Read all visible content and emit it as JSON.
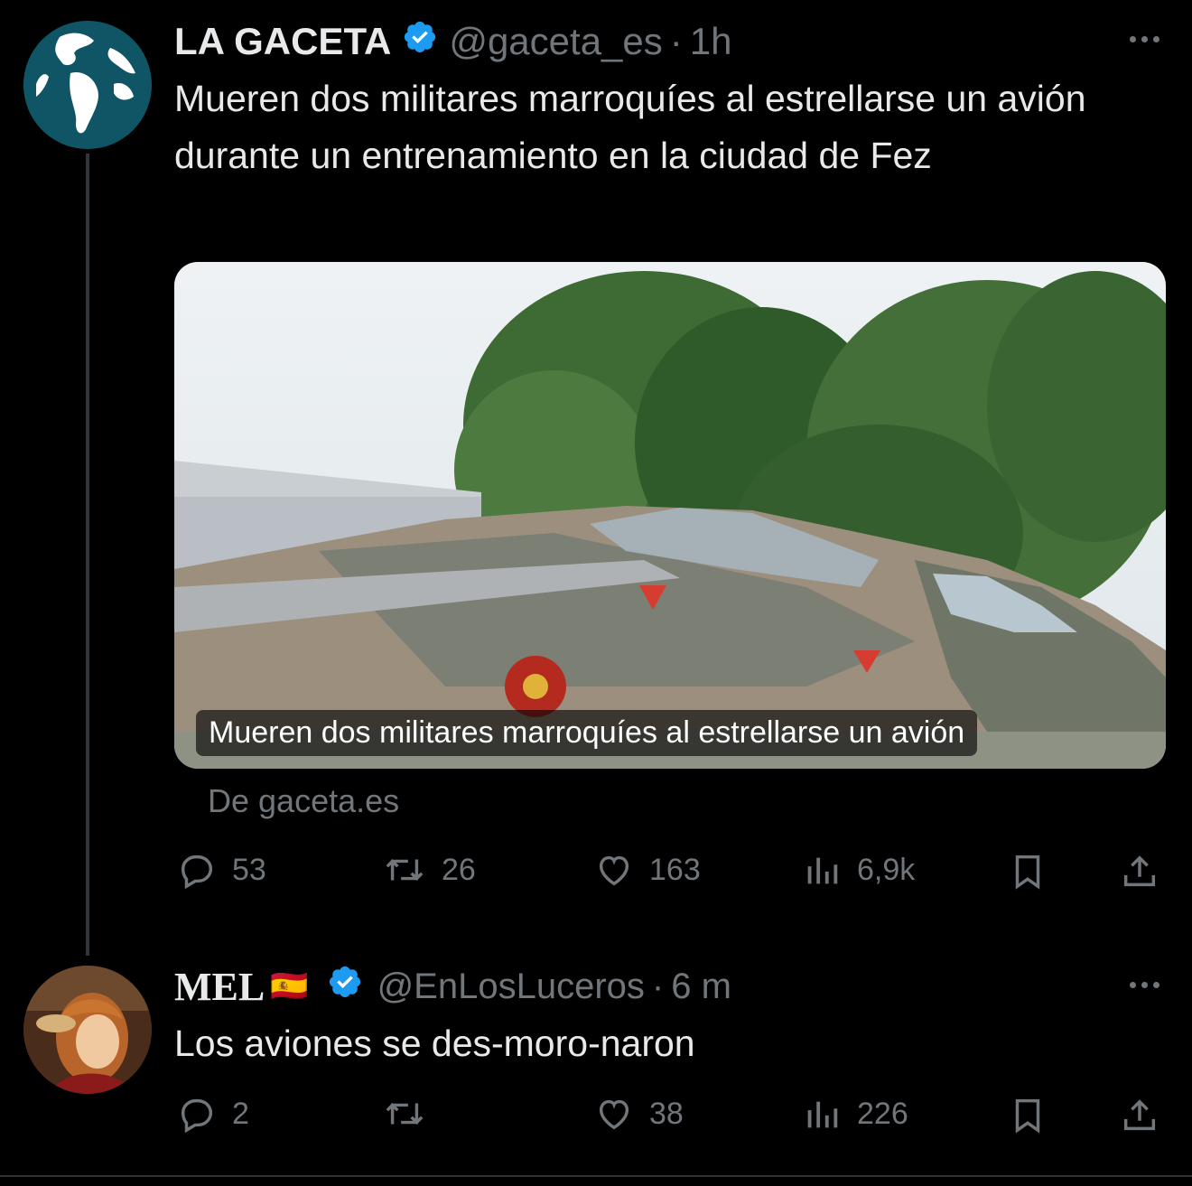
{
  "tweet1": {
    "name": "LA GACETA",
    "handle": "@gaceta_es",
    "separator": "·",
    "time": "1h",
    "text": "Mueren dos militares marroquíes al estrellarse un avión durante un entrenamiento en la ciudad de Fez",
    "card_caption": "Mueren dos militares marroquíes al estrellarse un avión",
    "source": "De gaceta.es",
    "replies": "53",
    "retweets": "26",
    "likes": "163",
    "views": "6,9k"
  },
  "tweet2": {
    "name": "MEL",
    "flag": "🇪🇸",
    "handle": "@EnLosLuceros",
    "separator": "·",
    "time": "6 m",
    "text": "Los aviones se des-moro-naron",
    "replies": "2",
    "retweets": "",
    "likes": "38",
    "views": "226"
  },
  "colors": {
    "background": "#000000",
    "text": "#e7e9ea",
    "muted": "#71767b",
    "verified": "#1d9bf0",
    "avatar_teal": "#0f5566"
  },
  "icons": [
    "globe-avatar",
    "verified-icon",
    "more-icon",
    "reply-icon",
    "retweet-icon",
    "like-icon",
    "views-icon",
    "bookmark-icon",
    "share-icon"
  ]
}
